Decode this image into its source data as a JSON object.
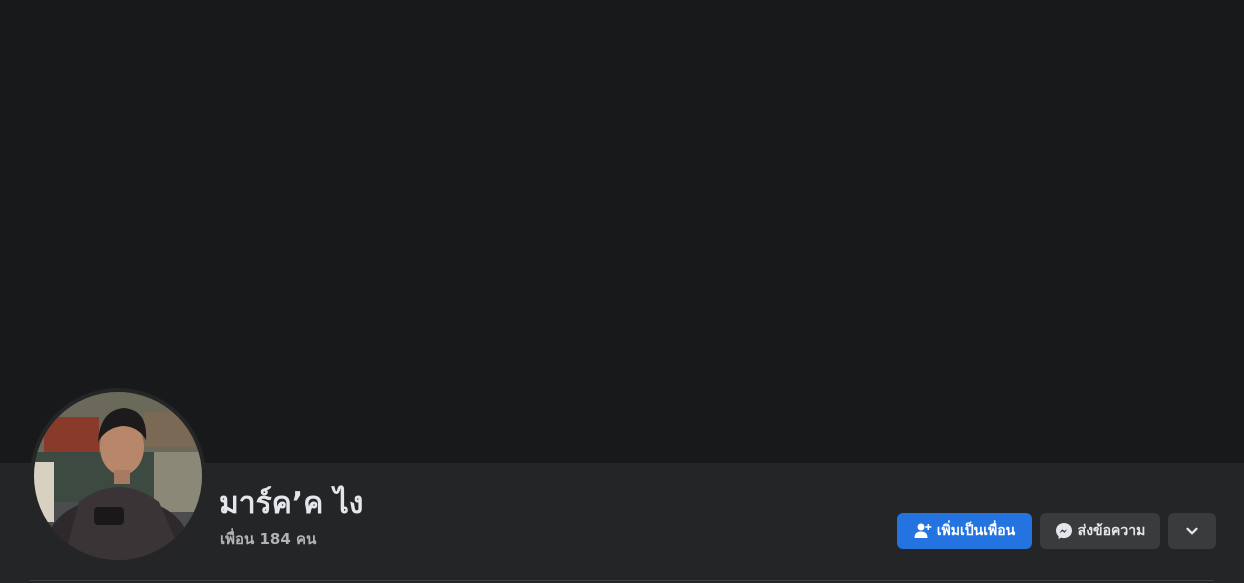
{
  "profile": {
    "name": "มาร์ค’ค ไง",
    "friends_count_text": "เพื่อน 184 คน"
  },
  "actions": {
    "add_friend_label": "เพิ่มเป็นเพื่อน",
    "message_label": "ส่งข้อความ"
  },
  "icons": {
    "add_friend": "person-add-icon",
    "message": "messenger-icon",
    "more": "chevron-down-icon"
  },
  "colors": {
    "primary_button": "#2374e1",
    "secondary_button": "#3a3b3c",
    "cover": "#18191a",
    "header_bg": "#242526"
  }
}
